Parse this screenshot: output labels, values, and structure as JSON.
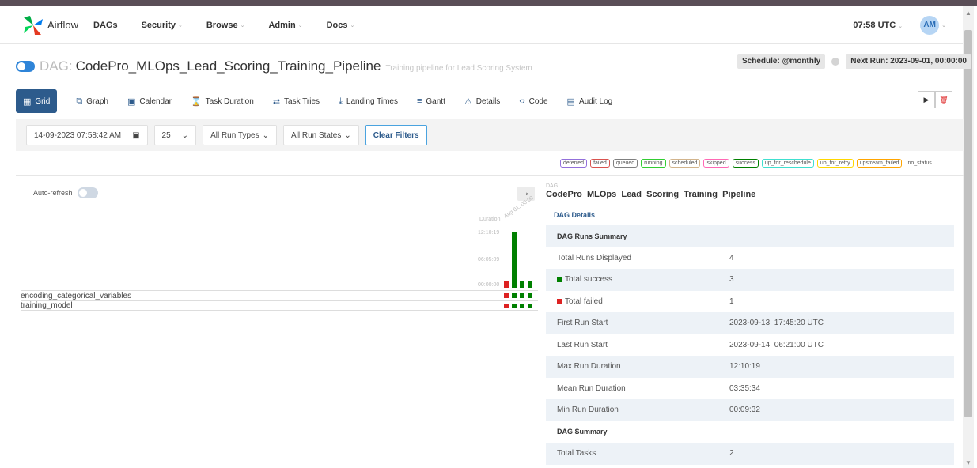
{
  "navbar": {
    "brand": "Airflow",
    "items": [
      {
        "label": "DAGs",
        "has_caret": false
      },
      {
        "label": "Security",
        "has_caret": true
      },
      {
        "label": "Browse",
        "has_caret": true
      },
      {
        "label": "Admin",
        "has_caret": true
      },
      {
        "label": "Docs",
        "has_caret": true
      }
    ],
    "time": "07:58 UTC",
    "avatar_initials": "AM"
  },
  "dag": {
    "prefix": "DAG:",
    "id": "CodePro_MLOps_Lead_Scoring_Training_Pipeline",
    "description": "Training pipeline for Lead Scoring System",
    "schedule": "Schedule: @monthly",
    "next_run": "Next Run: 2023-09-01, 00:00:00"
  },
  "tabs": [
    {
      "label": "Grid",
      "icon": "grid-icon",
      "glyph": "▦"
    },
    {
      "label": "Graph",
      "icon": "graph-icon",
      "glyph": "⧉"
    },
    {
      "label": "Calendar",
      "icon": "calendar-icon",
      "glyph": "▣"
    },
    {
      "label": "Task Duration",
      "icon": "hourglass-icon",
      "glyph": "⌛"
    },
    {
      "label": "Task Tries",
      "icon": "retry-icon",
      "glyph": "⇄"
    },
    {
      "label": "Landing Times",
      "icon": "landing-icon",
      "glyph": "⤓"
    },
    {
      "label": "Gantt",
      "icon": "gantt-icon",
      "glyph": "≡"
    },
    {
      "label": "Details",
      "icon": "warning-icon",
      "glyph": "⚠"
    },
    {
      "label": "Code",
      "icon": "code-icon",
      "glyph": "‹›"
    },
    {
      "label": "Audit Log",
      "icon": "audit-icon",
      "glyph": "▤"
    }
  ],
  "filters": {
    "date": "14-09-2023 07:58:42 AM",
    "num_runs": "25",
    "run_types": "All Run Types",
    "run_states": "All Run States",
    "clear": "Clear Filters"
  },
  "legend": [
    {
      "label": "deferred",
      "color": "#9370db"
    },
    {
      "label": "failed",
      "color": "#d9534f"
    },
    {
      "label": "queued",
      "color": "#808080"
    },
    {
      "label": "running",
      "color": "#32cd32"
    },
    {
      "label": "scheduled",
      "color": "#d2b48c"
    },
    {
      "label": "skipped",
      "color": "#ff69b4"
    },
    {
      "label": "success",
      "color": "#008000"
    },
    {
      "label": "up_for_reschedule",
      "color": "#40e0d0"
    },
    {
      "label": "up_for_retry",
      "color": "#ffd700"
    },
    {
      "label": "upstream_failed",
      "color": "#ffa500"
    },
    {
      "label": "no_status",
      "color": "none"
    }
  ],
  "grid": {
    "auto_refresh": "Auto-refresh",
    "duration_label": "Duration",
    "run_date_label": "Aug 01, 00:00",
    "ticks": [
      "12:10:19",
      "06:05:09",
      "00:00:00"
    ],
    "runs": [
      {
        "state": "failed",
        "fraction": 0.12
      },
      {
        "state": "success",
        "fraction": 1.0
      },
      {
        "state": "success",
        "fraction": 0.1
      },
      {
        "state": "success",
        "fraction": 0.12
      }
    ],
    "tasks": [
      {
        "name": "encoding_categorical_variables",
        "states": [
          "failed",
          "success",
          "success",
          "success"
        ]
      },
      {
        "name": "training_model",
        "states": [
          "failed",
          "success",
          "success",
          "success"
        ]
      }
    ],
    "colors": {
      "success": "#008000",
      "failed": "#d22"
    }
  },
  "details": {
    "small": "DAG",
    "title": "CodePro_MLOps_Lead_Scoring_Training_Pipeline",
    "link": "DAG Details",
    "rows": [
      {
        "k": "DAG Runs Summary",
        "v": "",
        "section": true
      },
      {
        "k": "Total Runs Displayed",
        "v": "4"
      },
      {
        "k": "Total success",
        "v": "3",
        "marker": "#008000"
      },
      {
        "k": "Total failed",
        "v": "1",
        "marker": "#d22"
      },
      {
        "k": "First Run Start",
        "v": "2023-09-13, 17:45:20 UTC"
      },
      {
        "k": "Last Run Start",
        "v": "2023-09-14, 06:21:00 UTC"
      },
      {
        "k": "Max Run Duration",
        "v": "12:10:19"
      },
      {
        "k": "Mean Run Duration",
        "v": "03:35:34"
      },
      {
        "k": "Min Run Duration",
        "v": "00:09:32"
      },
      {
        "k": "DAG Summary",
        "v": "",
        "section": true
      },
      {
        "k": "Total Tasks",
        "v": "2"
      }
    ]
  }
}
